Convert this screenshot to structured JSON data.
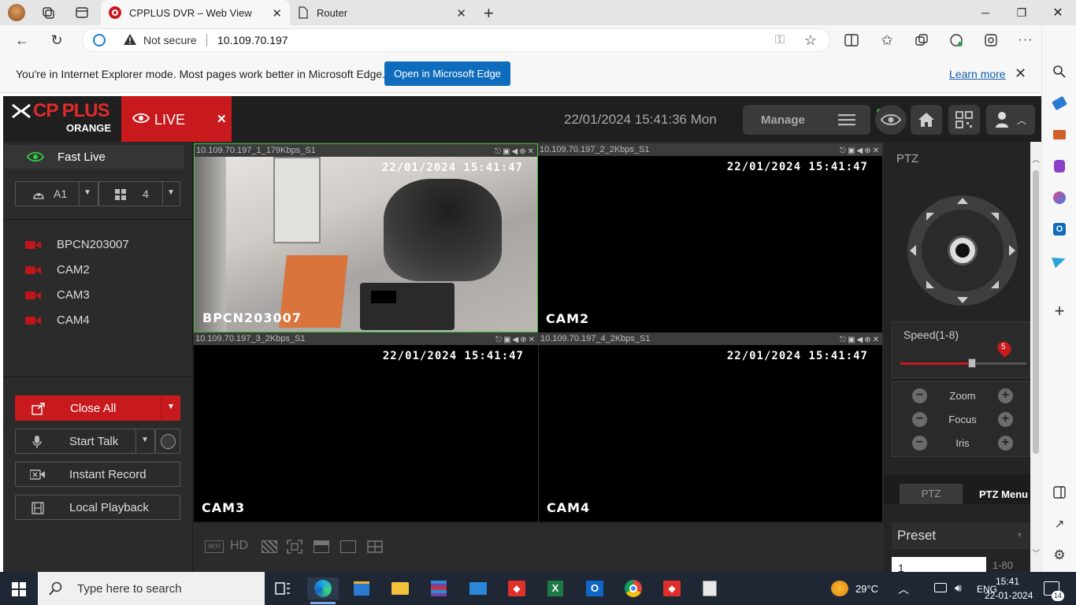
{
  "browser": {
    "tabs": [
      {
        "title": "CPPLUS DVR – Web View",
        "active": true
      },
      {
        "title": "Router",
        "active": false
      }
    ],
    "address": {
      "security": "Not secure",
      "url": "10.109.70.197"
    }
  },
  "ie_banner": {
    "message": "You're in Internet Explorer mode. Most pages work better in Microsoft Edge.",
    "open_button": "Open in Microsoft Edge",
    "learn_more": "Learn more"
  },
  "dvr": {
    "brand": {
      "name": "CP PLUS",
      "sub": "ORANGE"
    },
    "live_tab": "LIVE",
    "datetime": "22/01/2024 15:41:36 Mon",
    "manage": "Manage",
    "left": {
      "fast_live": "Fast Live",
      "stream_select": "A1",
      "split_select": "4",
      "channels": [
        "BPCN203007",
        "CAM2",
        "CAM3",
        "CAM4"
      ],
      "buttons": {
        "close_all": "Close All",
        "start_talk": "Start Talk",
        "instant_record": "Instant Record",
        "local_playback": "Local Playback"
      }
    },
    "tiles": [
      {
        "title": "10.109.70.197_1_179Kbps_S1",
        "osd_time": "22/01/2024 15:41:47",
        "osd_name": "BPCN203007"
      },
      {
        "title": "10.109.70.197_2_2Kbps_S1",
        "osd_time": "22/01/2024 15:41:47",
        "osd_name": "CAM2"
      },
      {
        "title": "10.109.70.197_3_2Kbps_S1",
        "osd_time": "22/01/2024 15:41:47",
        "osd_name": "CAM3"
      },
      {
        "title": "10.109.70.197_4_2Kbps_S1",
        "osd_time": "22/01/2024 15:41:47",
        "osd_name": "CAM4"
      }
    ],
    "bottom_bar": {
      "ratio": "W:H",
      "quality": "HD"
    },
    "ptz": {
      "header": "PTZ",
      "speed_label": "Speed(1-8)",
      "speed_value": "5",
      "speed_fraction": 0.57,
      "zoom": "Zoom",
      "focus": "Focus",
      "iris": "Iris",
      "tab_ptz": "PTZ",
      "tab_menu": "PTZ Menu",
      "preset": "Preset",
      "preset_value": "1",
      "preset_range": "1-80"
    }
  },
  "taskbar": {
    "search_placeholder": "Type here to search",
    "temperature": "29°C",
    "language": "ENG",
    "time": "15:41",
    "date": "22-01-2024",
    "notifications": "14"
  }
}
